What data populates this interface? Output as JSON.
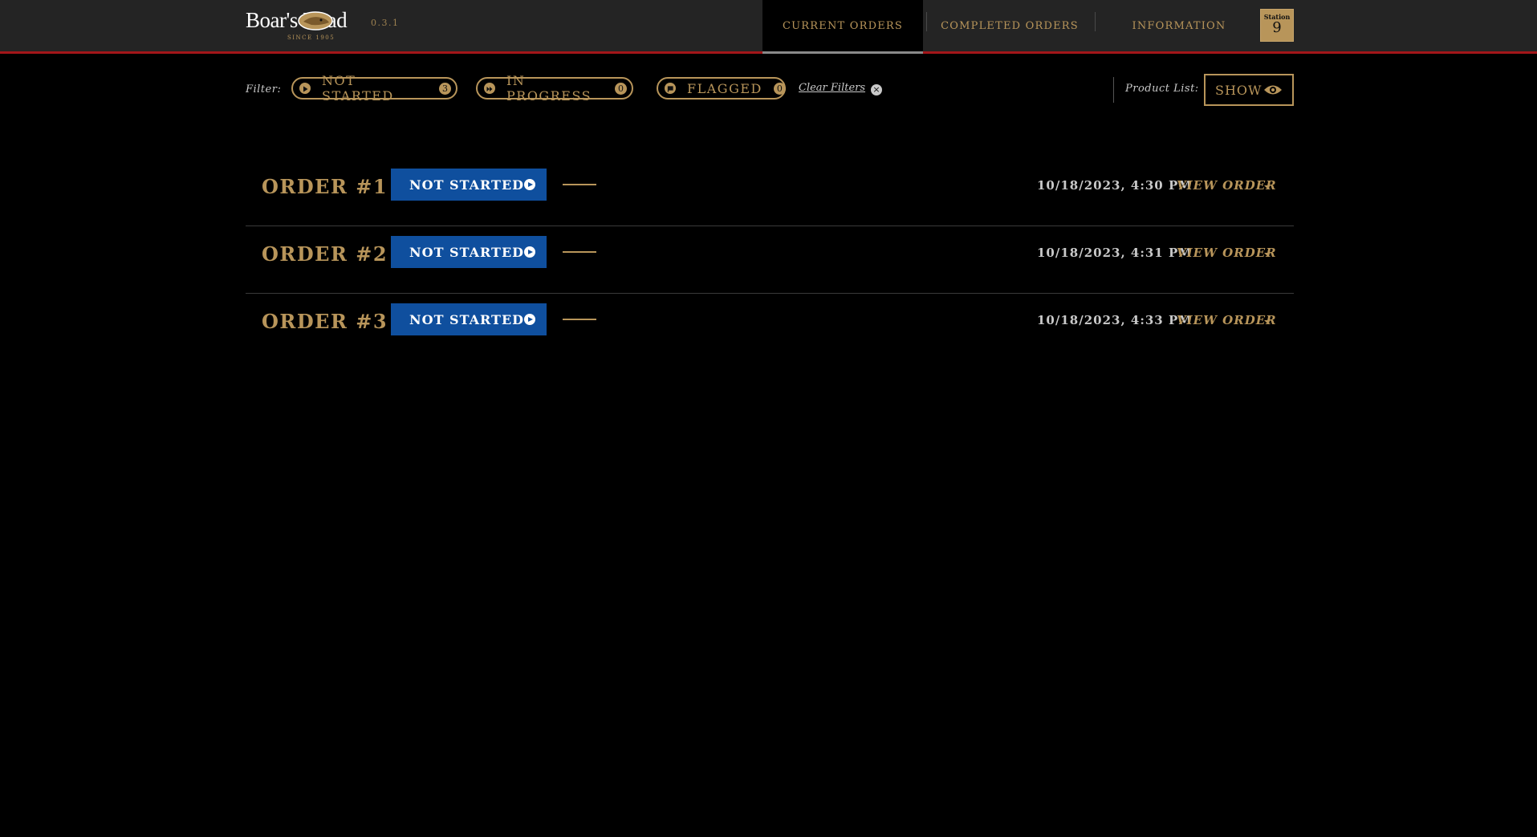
{
  "header": {
    "logo_text": "Boar's Head",
    "logo_since": "SINCE 1905",
    "version": "0.3.1",
    "tabs": [
      {
        "label": "CURRENT ORDERS",
        "active": true
      },
      {
        "label": "COMPLETED ORDERS",
        "active": false
      },
      {
        "label": "INFORMATION",
        "active": false
      }
    ],
    "station": {
      "label": "Station",
      "number": "9"
    }
  },
  "filters": {
    "label": "Filter:",
    "items": [
      {
        "label": "NOT STARTED",
        "count": "3",
        "icon": "play-circle-icon"
      },
      {
        "label": "IN PROGRESS",
        "count": "0",
        "icon": "fast-forward-circle-icon"
      },
      {
        "label": "FLAGGED",
        "count": "0",
        "icon": "flag-circle-icon"
      }
    ],
    "clear_label": "Clear Filters",
    "clear_icon": "close-circle-icon"
  },
  "product_list": {
    "label": "Product List:",
    "button_label": "SHOW",
    "button_icon": "eye-icon"
  },
  "orders": [
    {
      "title": "ORDER #1",
      "status": "NOT STARTED",
      "time": "10/18/2023, 4:30 PM",
      "action": "VIEW ORDER"
    },
    {
      "title": "ORDER #2",
      "status": "NOT STARTED",
      "time": "10/18/2023, 4:31 PM",
      "action": "VIEW ORDER"
    },
    {
      "title": "ORDER #3",
      "status": "NOT STARTED",
      "time": "10/18/2023, 4:33 PM",
      "action": "VIEW ORDER"
    }
  ],
  "colors": {
    "accent_gold": "#b8955a",
    "status_blue": "#0f4f9e",
    "header_bg": "#242424",
    "header_border": "#a3161a",
    "background": "#000000"
  }
}
